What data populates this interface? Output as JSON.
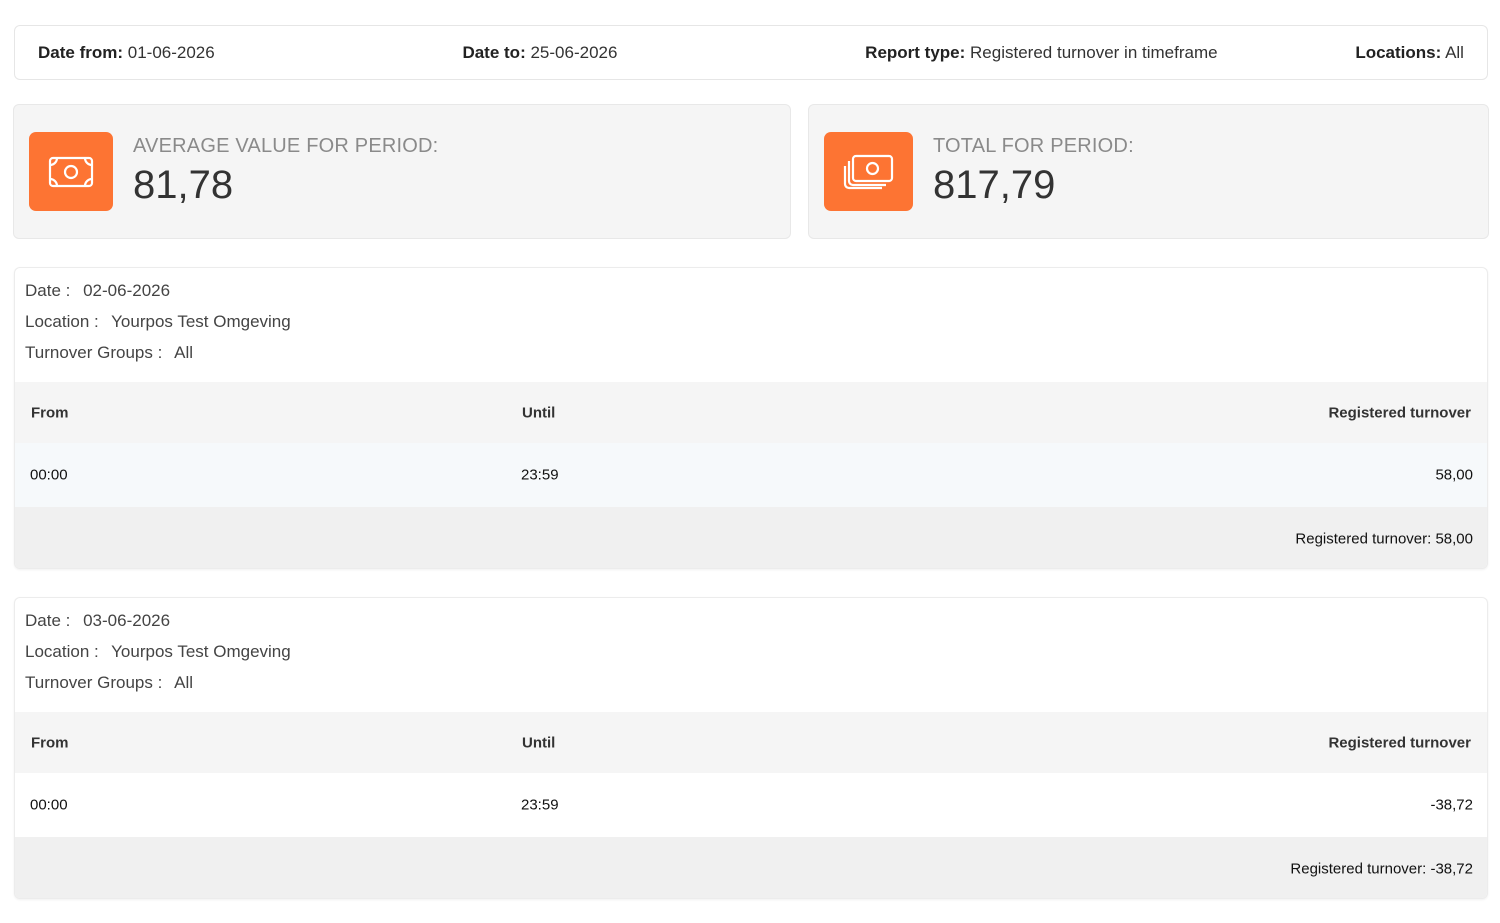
{
  "filters": {
    "date_from_label": "Date from:",
    "date_from_value": "01-06-2026",
    "date_to_label": "Date to:",
    "date_to_value": "25-06-2026",
    "report_type_label": "Report type:",
    "report_type_value": "Registered turnover in timeframe",
    "locations_label": "Locations:",
    "locations_value": "All"
  },
  "stats": {
    "average": {
      "label": "AVERAGE VALUE FOR PERIOD:",
      "value": "81,78",
      "icon": "money-bill-icon"
    },
    "total": {
      "label": "TOTAL FOR PERIOD:",
      "value": "817,79",
      "icon": "money-bills-icon"
    }
  },
  "accent_color": "#fd7433",
  "day_reports": [
    {
      "date_label": "Date :",
      "date_value": "02-06-2026",
      "location_label": "Location :",
      "location_value": "Yourpos Test Omgeving",
      "groups_label": "Turnover Groups :",
      "groups_value": "All",
      "columns": [
        "From",
        "Until",
        "Registered turnover"
      ],
      "rows": [
        {
          "from": "00:00",
          "until": "23:59",
          "registered": "58,00"
        }
      ],
      "footer": "Registered turnover: 58,00"
    },
    {
      "date_label": "Date :",
      "date_value": "03-06-2026",
      "location_label": "Location :",
      "location_value": "Yourpos Test Omgeving",
      "groups_label": "Turnover Groups :",
      "groups_value": "All",
      "columns": [
        "From",
        "Until",
        "Registered turnover"
      ],
      "rows": [
        {
          "from": "00:00",
          "until": "23:59",
          "registered": "-38,72"
        }
      ],
      "footer": "Registered turnover: -38,72"
    }
  ]
}
